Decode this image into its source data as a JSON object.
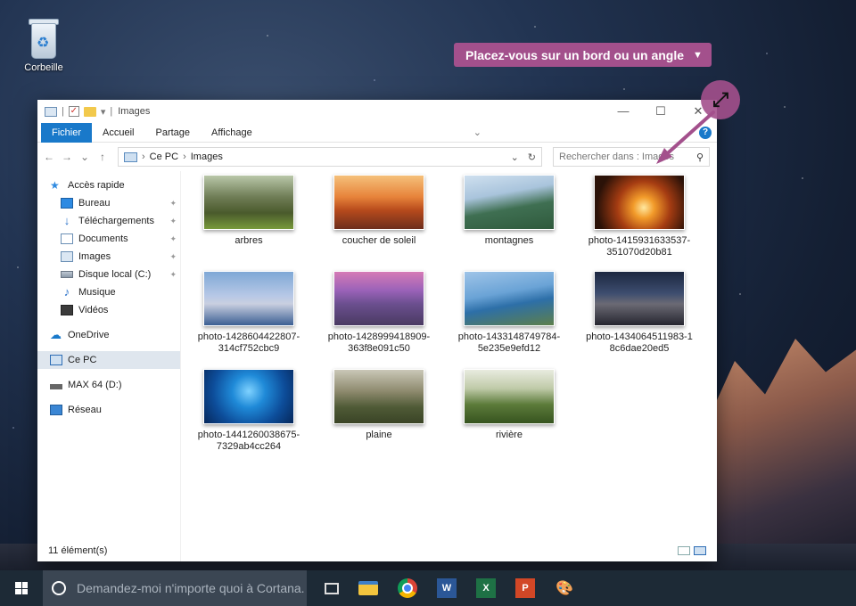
{
  "desktop": {
    "recycle_bin_label": "Corbeille"
  },
  "tooltip": {
    "text": "Placez-vous sur un bord ou un angle",
    "color": "#a3508c"
  },
  "window": {
    "title": "Images",
    "ribbon_tabs": [
      "Fichier",
      "Accueil",
      "Partage",
      "Affichage"
    ],
    "address": {
      "segments": [
        "Ce PC",
        "Images"
      ]
    },
    "search_placeholder": "Rechercher dans : Images",
    "sidebar": [
      {
        "label": "Accès rapide",
        "icon": "star-icon"
      },
      {
        "label": "Bureau",
        "icon": "desktop-icon",
        "pinned": true
      },
      {
        "label": "Téléchargements",
        "icon": "download-icon",
        "pinned": true
      },
      {
        "label": "Documents",
        "icon": "documents-icon",
        "pinned": true
      },
      {
        "label": "Images",
        "icon": "pictures-icon",
        "pinned": true
      },
      {
        "label": "Disque local (C:)",
        "icon": "drive-icon",
        "pinned": true
      },
      {
        "label": "Musique",
        "icon": "music-icon"
      },
      {
        "label": "Vidéos",
        "icon": "video-icon"
      },
      {
        "label": "OneDrive",
        "icon": "cloud-icon"
      },
      {
        "label": "Ce PC",
        "icon": "pc-icon",
        "selected": true
      },
      {
        "label": "MAX 64 (D:)",
        "icon": "usb-drive-icon"
      },
      {
        "label": "Réseau",
        "icon": "network-icon"
      }
    ],
    "files": [
      {
        "name": "arbres"
      },
      {
        "name": "coucher de soleil"
      },
      {
        "name": "montagnes"
      },
      {
        "name": "photo-1415931633537-351070d20b81"
      },
      {
        "name": "photo-1428604422807-314cf752cbc9"
      },
      {
        "name": "photo-1428999418909-363f8e091c50"
      },
      {
        "name": "photo-1433148749784-5e235e9efd12"
      },
      {
        "name": "photo-1434064511983-18c6dae20ed5"
      },
      {
        "name": "photo-1441260038675-7329ab4cc264"
      },
      {
        "name": "plaine"
      },
      {
        "name": "rivière"
      }
    ],
    "status": "11 élément(s)"
  },
  "taskbar": {
    "cortana_placeholder": "Demandez-moi n'importe quoi à Cortana."
  }
}
